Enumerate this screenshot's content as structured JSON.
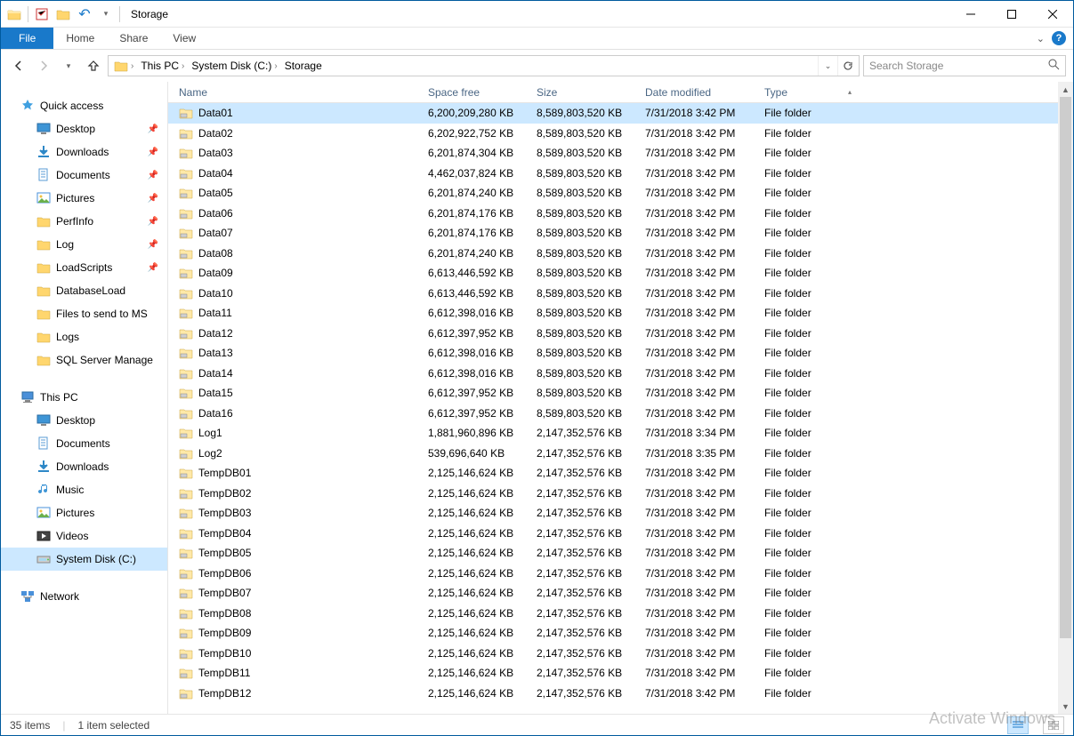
{
  "window": {
    "title": "Storage"
  },
  "ribbon": {
    "file": "File",
    "tabs": [
      "Home",
      "Share",
      "View"
    ]
  },
  "address": {
    "crumbs": [
      "This PC",
      "System Disk (C:)",
      "Storage"
    ]
  },
  "search": {
    "placeholder": "Search Storage"
  },
  "sidebar": {
    "quick": {
      "label": "Quick access",
      "items": [
        {
          "label": "Desktop",
          "icon": "desktop",
          "pin": true
        },
        {
          "label": "Downloads",
          "icon": "downloads",
          "pin": true
        },
        {
          "label": "Documents",
          "icon": "documents",
          "pin": true
        },
        {
          "label": "Pictures",
          "icon": "pictures",
          "pin": true
        },
        {
          "label": "PerfInfo",
          "icon": "folder",
          "pin": true
        },
        {
          "label": "Log",
          "icon": "folder",
          "pin": true
        },
        {
          "label": "LoadScripts",
          "icon": "folder",
          "pin": true
        },
        {
          "label": "DatabaseLoad",
          "icon": "folder",
          "pin": false
        },
        {
          "label": "Files to send to MS",
          "icon": "folder",
          "pin": false
        },
        {
          "label": "Logs",
          "icon": "folder",
          "pin": false
        },
        {
          "label": "SQL Server Manage",
          "icon": "folder",
          "pin": false
        }
      ]
    },
    "thispc": {
      "label": "This PC",
      "items": [
        {
          "label": "Desktop",
          "icon": "desktop"
        },
        {
          "label": "Documents",
          "icon": "documents"
        },
        {
          "label": "Downloads",
          "icon": "downloads"
        },
        {
          "label": "Music",
          "icon": "music"
        },
        {
          "label": "Pictures",
          "icon": "pictures"
        },
        {
          "label": "Videos",
          "icon": "videos"
        },
        {
          "label": "System Disk (C:)",
          "icon": "disk",
          "active": true
        }
      ]
    },
    "network": {
      "label": "Network"
    }
  },
  "columns": {
    "name": "Name",
    "space": "Space free",
    "size": "Size",
    "date": "Date modified",
    "type": "Type"
  },
  "files": [
    {
      "name": "Data01",
      "space": "6,200,209,280 KB",
      "size": "8,589,803,520 KB",
      "date": "7/31/2018 3:42 PM",
      "type": "File folder",
      "selected": true
    },
    {
      "name": "Data02",
      "space": "6,202,922,752 KB",
      "size": "8,589,803,520 KB",
      "date": "7/31/2018 3:42 PM",
      "type": "File folder"
    },
    {
      "name": "Data03",
      "space": "6,201,874,304 KB",
      "size": "8,589,803,520 KB",
      "date": "7/31/2018 3:42 PM",
      "type": "File folder"
    },
    {
      "name": "Data04",
      "space": "4,462,037,824 KB",
      "size": "8,589,803,520 KB",
      "date": "7/31/2018 3:42 PM",
      "type": "File folder"
    },
    {
      "name": "Data05",
      "space": "6,201,874,240 KB",
      "size": "8,589,803,520 KB",
      "date": "7/31/2018 3:42 PM",
      "type": "File folder"
    },
    {
      "name": "Data06",
      "space": "6,201,874,176 KB",
      "size": "8,589,803,520 KB",
      "date": "7/31/2018 3:42 PM",
      "type": "File folder"
    },
    {
      "name": "Data07",
      "space": "6,201,874,176 KB",
      "size": "8,589,803,520 KB",
      "date": "7/31/2018 3:42 PM",
      "type": "File folder"
    },
    {
      "name": "Data08",
      "space": "6,201,874,240 KB",
      "size": "8,589,803,520 KB",
      "date": "7/31/2018 3:42 PM",
      "type": "File folder"
    },
    {
      "name": "Data09",
      "space": "6,613,446,592 KB",
      "size": "8,589,803,520 KB",
      "date": "7/31/2018 3:42 PM",
      "type": "File folder"
    },
    {
      "name": "Data10",
      "space": "6,613,446,592 KB",
      "size": "8,589,803,520 KB",
      "date": "7/31/2018 3:42 PM",
      "type": "File folder"
    },
    {
      "name": "Data11",
      "space": "6,612,398,016 KB",
      "size": "8,589,803,520 KB",
      "date": "7/31/2018 3:42 PM",
      "type": "File folder"
    },
    {
      "name": "Data12",
      "space": "6,612,397,952 KB",
      "size": "8,589,803,520 KB",
      "date": "7/31/2018 3:42 PM",
      "type": "File folder"
    },
    {
      "name": "Data13",
      "space": "6,612,398,016 KB",
      "size": "8,589,803,520 KB",
      "date": "7/31/2018 3:42 PM",
      "type": "File folder"
    },
    {
      "name": "Data14",
      "space": "6,612,398,016 KB",
      "size": "8,589,803,520 KB",
      "date": "7/31/2018 3:42 PM",
      "type": "File folder"
    },
    {
      "name": "Data15",
      "space": "6,612,397,952 KB",
      "size": "8,589,803,520 KB",
      "date": "7/31/2018 3:42 PM",
      "type": "File folder"
    },
    {
      "name": "Data16",
      "space": "6,612,397,952 KB",
      "size": "8,589,803,520 KB",
      "date": "7/31/2018 3:42 PM",
      "type": "File folder"
    },
    {
      "name": "Log1",
      "space": "1,881,960,896 KB",
      "size": "2,147,352,576 KB",
      "date": "7/31/2018 3:34 PM",
      "type": "File folder"
    },
    {
      "name": "Log2",
      "space": "539,696,640 KB",
      "size": "2,147,352,576 KB",
      "date": "7/31/2018 3:35 PM",
      "type": "File folder"
    },
    {
      "name": "TempDB01",
      "space": "2,125,146,624 KB",
      "size": "2,147,352,576 KB",
      "date": "7/31/2018 3:42 PM",
      "type": "File folder"
    },
    {
      "name": "TempDB02",
      "space": "2,125,146,624 KB",
      "size": "2,147,352,576 KB",
      "date": "7/31/2018 3:42 PM",
      "type": "File folder"
    },
    {
      "name": "TempDB03",
      "space": "2,125,146,624 KB",
      "size": "2,147,352,576 KB",
      "date": "7/31/2018 3:42 PM",
      "type": "File folder"
    },
    {
      "name": "TempDB04",
      "space": "2,125,146,624 KB",
      "size": "2,147,352,576 KB",
      "date": "7/31/2018 3:42 PM",
      "type": "File folder"
    },
    {
      "name": "TempDB05",
      "space": "2,125,146,624 KB",
      "size": "2,147,352,576 KB",
      "date": "7/31/2018 3:42 PM",
      "type": "File folder"
    },
    {
      "name": "TempDB06",
      "space": "2,125,146,624 KB",
      "size": "2,147,352,576 KB",
      "date": "7/31/2018 3:42 PM",
      "type": "File folder"
    },
    {
      "name": "TempDB07",
      "space": "2,125,146,624 KB",
      "size": "2,147,352,576 KB",
      "date": "7/31/2018 3:42 PM",
      "type": "File folder"
    },
    {
      "name": "TempDB08",
      "space": "2,125,146,624 KB",
      "size": "2,147,352,576 KB",
      "date": "7/31/2018 3:42 PM",
      "type": "File folder"
    },
    {
      "name": "TempDB09",
      "space": "2,125,146,624 KB",
      "size": "2,147,352,576 KB",
      "date": "7/31/2018 3:42 PM",
      "type": "File folder"
    },
    {
      "name": "TempDB10",
      "space": "2,125,146,624 KB",
      "size": "2,147,352,576 KB",
      "date": "7/31/2018 3:42 PM",
      "type": "File folder"
    },
    {
      "name": "TempDB11",
      "space": "2,125,146,624 KB",
      "size": "2,147,352,576 KB",
      "date": "7/31/2018 3:42 PM",
      "type": "File folder"
    },
    {
      "name": "TempDB12",
      "space": "2,125,146,624 KB",
      "size": "2,147,352,576 KB",
      "date": "7/31/2018 3:42 PM",
      "type": "File folder"
    }
  ],
  "status": {
    "count": "35 items",
    "selected": "1 item selected"
  },
  "watermark": "Activate Windows"
}
